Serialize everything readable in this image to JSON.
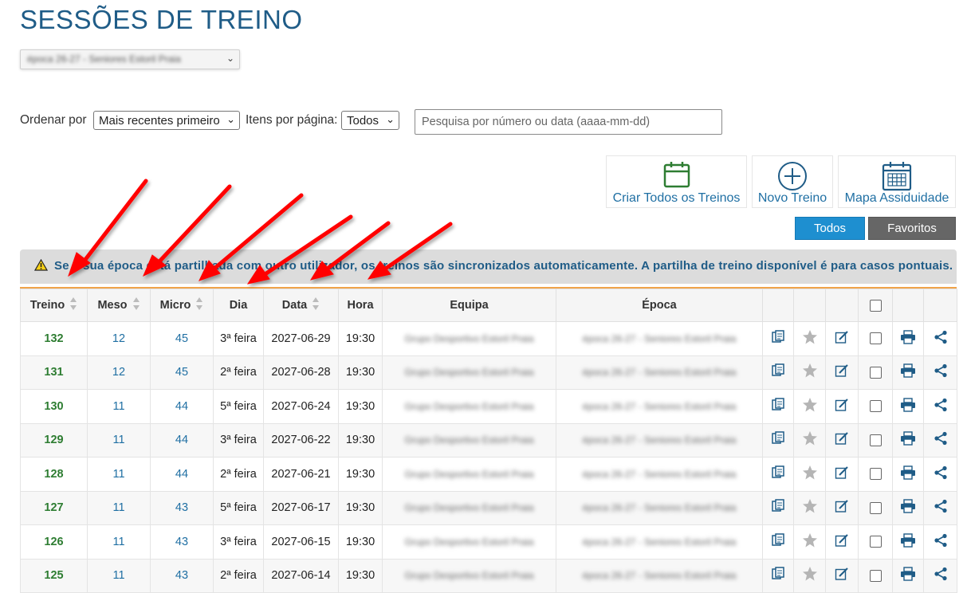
{
  "page": {
    "title": "SESSÕES DE TREINO",
    "season_selector": "época 26-27 - Seniores Estoril Praia"
  },
  "controls": {
    "order_label": "Ordenar por",
    "order_value": "Mais recentes primeiro",
    "items_label": "Itens por página:",
    "items_value": "Todos",
    "search_placeholder": "Pesquisa por número ou data (aaaa-mm-dd)"
  },
  "actions": {
    "create_all": "Criar Todos os Treinos",
    "new": "Novo Treino",
    "attendance": "Mapa Assiduidade"
  },
  "tabs": {
    "all": "Todos",
    "favorites": "Favoritos"
  },
  "notice": "Se a sua época está partilhada com outro utilizador, os treinos são sincronizados automaticamente. A partilha de treino disponível é para casos pontuais.",
  "table": {
    "headers": {
      "treino": "Treino",
      "meso": "Meso",
      "micro": "Micro",
      "dia": "Dia",
      "data": "Data",
      "hora": "Hora",
      "equipa": "Equipa",
      "epoca": "Época"
    },
    "rows": [
      {
        "treino": "132",
        "meso": "12",
        "micro": "45",
        "dia": "3ª feira",
        "data": "2027-06-29",
        "hora": "19:30",
        "equipa": "Grupo Desportivo Estoril Praia",
        "epoca": "época 26-27 - Seniores Estoril Praia"
      },
      {
        "treino": "131",
        "meso": "12",
        "micro": "45",
        "dia": "2ª feira",
        "data": "2027-06-28",
        "hora": "19:30",
        "equipa": "Grupo Desportivo Estoril Praia",
        "epoca": "época 26-27 - Seniores Estoril Praia"
      },
      {
        "treino": "130",
        "meso": "11",
        "micro": "44",
        "dia": "5ª feira",
        "data": "2027-06-24",
        "hora": "19:30",
        "equipa": "Grupo Desportivo Estoril Praia",
        "epoca": "época 26-27 - Seniores Estoril Praia"
      },
      {
        "treino": "129",
        "meso": "11",
        "micro": "44",
        "dia": "3ª feira",
        "data": "2027-06-22",
        "hora": "19:30",
        "equipa": "Grupo Desportivo Estoril Praia",
        "epoca": "época 26-27 - Seniores Estoril Praia"
      },
      {
        "treino": "128",
        "meso": "11",
        "micro": "44",
        "dia": "2ª feira",
        "data": "2027-06-21",
        "hora": "19:30",
        "equipa": "Grupo Desportivo Estoril Praia",
        "epoca": "época 26-27 - Seniores Estoril Praia"
      },
      {
        "treino": "127",
        "meso": "11",
        "micro": "43",
        "dia": "5ª feira",
        "data": "2027-06-17",
        "hora": "19:30",
        "equipa": "Grupo Desportivo Estoril Praia",
        "epoca": "época 26-27 - Seniores Estoril Praia"
      },
      {
        "treino": "126",
        "meso": "11",
        "micro": "43",
        "dia": "3ª feira",
        "data": "2027-06-15",
        "hora": "19:30",
        "equipa": "Grupo Desportivo Estoril Praia",
        "epoca": "época 26-27 - Seniores Estoril Praia"
      },
      {
        "treino": "125",
        "meso": "11",
        "micro": "43",
        "dia": "2ª feira",
        "data": "2027-06-14",
        "hora": "19:30",
        "equipa": "Grupo Desportivo Estoril Praia",
        "epoca": "época 26-27 - Seniores Estoril Praia"
      }
    ]
  },
  "icons": [
    "copy-icon",
    "star-icon",
    "edit-icon",
    "checkbox",
    "print-icon",
    "share-icon",
    "calendar-icon",
    "plus-circle-icon",
    "calendar-grid-icon",
    "warning-icon",
    "red-arrow-annotation"
  ],
  "colors": {
    "title": "#1f5c87",
    "link": "#1f6fa3",
    "treino_number": "#2e7d32",
    "tab_active": "#1e8fd0",
    "tab_inactive": "#666666",
    "notice_bg": "#dcdcdc",
    "accent_line": "#f0a34a",
    "create_icon": "#2e7d32",
    "annotation_arrow": "#ff0000"
  }
}
